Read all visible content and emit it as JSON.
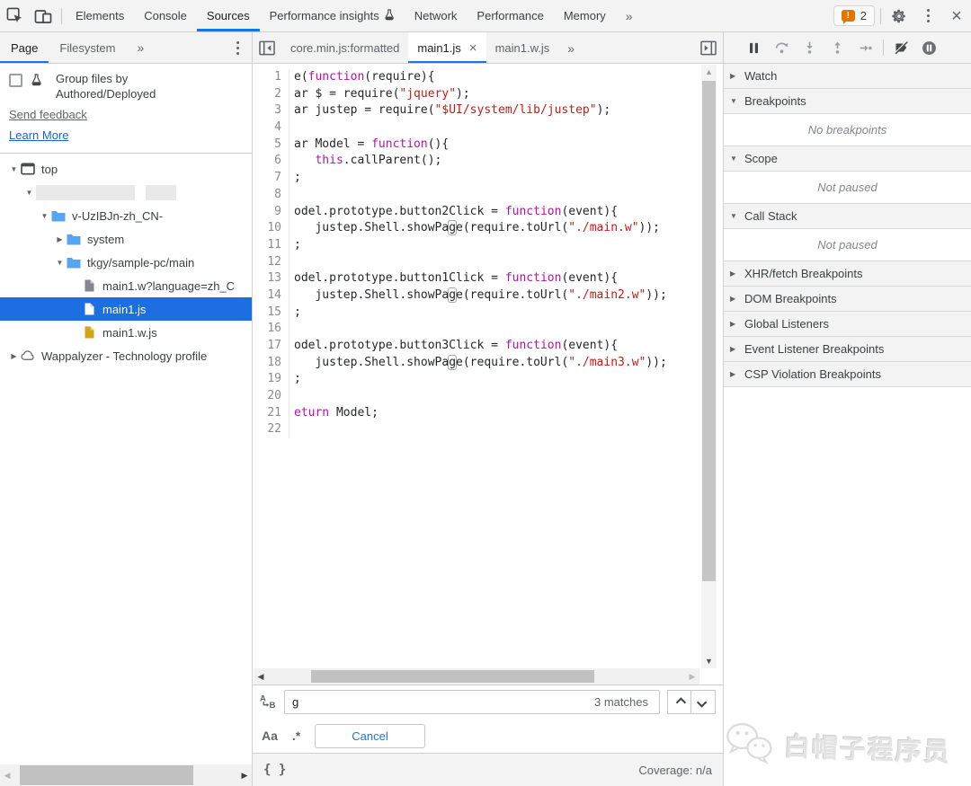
{
  "chrome": {
    "main_tabs": [
      {
        "label": "Elements"
      },
      {
        "label": "Console"
      },
      {
        "label": "Sources",
        "active": true
      },
      {
        "label": "Performance insights",
        "icon": "beaker"
      },
      {
        "label": "Network"
      },
      {
        "label": "Performance"
      },
      {
        "label": "Memory"
      }
    ],
    "overflow_label": "»",
    "issues_count": "2",
    "colors": {
      "accent": "#1a73e8",
      "warning": "#e37400",
      "selection": "#1d6ee0",
      "folder": "#57a4f2"
    }
  },
  "navigator": {
    "tabs": [
      {
        "label": "Page",
        "active": true
      },
      {
        "label": "Filesystem"
      }
    ],
    "overflow_label": "»",
    "banner": {
      "checkbox_label": "Group files by Authored/Deployed",
      "send_feedback": "Send feedback",
      "learn_more": "Learn More"
    },
    "tree": [
      {
        "label": "top",
        "level": 0,
        "exp": "down",
        "icon": "frame"
      },
      {
        "label": "",
        "level": 1,
        "exp": "down",
        "icon": "redacted"
      },
      {
        "label": "v-UzIBJn-zh_CN-",
        "level": 2,
        "exp": "down",
        "icon": "folder"
      },
      {
        "label": "system",
        "level": 3,
        "exp": "right",
        "icon": "folder"
      },
      {
        "label": "tkgy/sample-pc/main",
        "level": 3,
        "exp": "down",
        "icon": "folder"
      },
      {
        "label": "main1.w?language=zh_C",
        "level": 4,
        "exp": "none",
        "icon": "doc-gray"
      },
      {
        "label": "main1.js",
        "level": 4,
        "exp": "none",
        "icon": "doc-white",
        "selected": true
      },
      {
        "label": "main1.w.js",
        "level": 4,
        "exp": "none",
        "icon": "doc-gold"
      },
      {
        "label": "Wappalyzer - Technology profile",
        "level": 0,
        "exp": "right",
        "icon": "cloud"
      }
    ]
  },
  "editor": {
    "tabs": [
      {
        "label": "core.min.js:formatted"
      },
      {
        "label": "main1.js",
        "active": true,
        "closable": true
      },
      {
        "label": "main1.w.js"
      }
    ],
    "overflow_label": "»",
    "lines": [
      {
        "n": "1",
        "seg": [
          [
            "p",
            "e("
          ],
          [
            "k",
            "function"
          ],
          [
            "p",
            "(require){"
          ]
        ]
      },
      {
        "n": "2",
        "seg": [
          [
            "p",
            "ar $ = require("
          ],
          [
            "s",
            "\"jquery\""
          ],
          [
            "p",
            ");"
          ]
        ]
      },
      {
        "n": "3",
        "seg": [
          [
            "p",
            "ar justep = require("
          ],
          [
            "s",
            "\"$UI/system/lib/justep\""
          ],
          [
            "p",
            ");"
          ]
        ]
      },
      {
        "n": "4",
        "seg": []
      },
      {
        "n": "5",
        "seg": [
          [
            "p",
            "ar Model = "
          ],
          [
            "k",
            "function"
          ],
          [
            "p",
            "(){"
          ]
        ]
      },
      {
        "n": "6",
        "seg": [
          [
            "p",
            "   "
          ],
          [
            "k",
            "this"
          ],
          [
            "p",
            ".callParent();"
          ]
        ]
      },
      {
        "n": "7",
        "seg": [
          [
            "p",
            ";"
          ]
        ]
      },
      {
        "n": "8",
        "seg": []
      },
      {
        "n": "9",
        "seg": [
          [
            "p",
            "odel.prototype.button2Click = "
          ],
          [
            "k",
            "function"
          ],
          [
            "p",
            "(event){"
          ]
        ]
      },
      {
        "n": "10",
        "seg": [
          [
            "p",
            "   justep.Shell.showPa"
          ],
          [
            "m",
            "g"
          ],
          [
            "p",
            "e(require.toUrl("
          ],
          [
            "s",
            "\"./main.w\""
          ],
          [
            "p",
            "));"
          ]
        ]
      },
      {
        "n": "11",
        "seg": [
          [
            "p",
            ";"
          ]
        ]
      },
      {
        "n": "12",
        "seg": []
      },
      {
        "n": "13",
        "seg": [
          [
            "p",
            "odel.prototype.button1Click = "
          ],
          [
            "k",
            "function"
          ],
          [
            "p",
            "(event){"
          ]
        ]
      },
      {
        "n": "14",
        "seg": [
          [
            "p",
            "   justep.Shell.showPa"
          ],
          [
            "m",
            "g"
          ],
          [
            "p",
            "e(require.toUrl("
          ],
          [
            "s",
            "\"./main2.w\""
          ],
          [
            "p",
            "));"
          ]
        ]
      },
      {
        "n": "15",
        "seg": [
          [
            "p",
            ";"
          ]
        ]
      },
      {
        "n": "16",
        "seg": []
      },
      {
        "n": "17",
        "seg": [
          [
            "p",
            "odel.prototype.button3Click = "
          ],
          [
            "k",
            "function"
          ],
          [
            "p",
            "(event){"
          ]
        ]
      },
      {
        "n": "18",
        "seg": [
          [
            "p",
            "   justep.Shell.showPa"
          ],
          [
            "m",
            "g"
          ],
          [
            "p",
            "e(require.toUrl("
          ],
          [
            "s",
            "\"./main3.w\""
          ],
          [
            "p",
            "));"
          ]
        ]
      },
      {
        "n": "19",
        "seg": [
          [
            "p",
            ";"
          ]
        ]
      },
      {
        "n": "20",
        "seg": []
      },
      {
        "n": "21",
        "seg": [
          [
            "k",
            "eturn"
          ],
          [
            "p",
            " Model;"
          ]
        ]
      },
      {
        "n": "22",
        "seg": []
      }
    ]
  },
  "debugger_pane": {
    "sections": [
      {
        "label": "Watch",
        "state": "collapsed"
      },
      {
        "label": "Breakpoints",
        "state": "expanded",
        "content": "No breakpoints"
      },
      {
        "label": "Scope",
        "state": "expanded",
        "content": "Not paused"
      },
      {
        "label": "Call Stack",
        "state": "expanded",
        "content": "Not paused"
      },
      {
        "label": "XHR/fetch Breakpoints",
        "state": "collapsed"
      },
      {
        "label": "DOM Breakpoints",
        "state": "collapsed"
      },
      {
        "label": "Global Listeners",
        "state": "collapsed"
      },
      {
        "label": "Event Listener Breakpoints",
        "state": "collapsed"
      },
      {
        "label": "CSP Violation Breakpoints",
        "state": "collapsed"
      }
    ]
  },
  "search": {
    "query": "g",
    "matches_label": "3 matches",
    "cancel_label": "Cancel",
    "match_case_label": "Aa",
    "regex_label": ".*"
  },
  "status_bar": {
    "coverage": "Coverage: n/a"
  },
  "watermark": {
    "text": "白帽子程序员"
  }
}
